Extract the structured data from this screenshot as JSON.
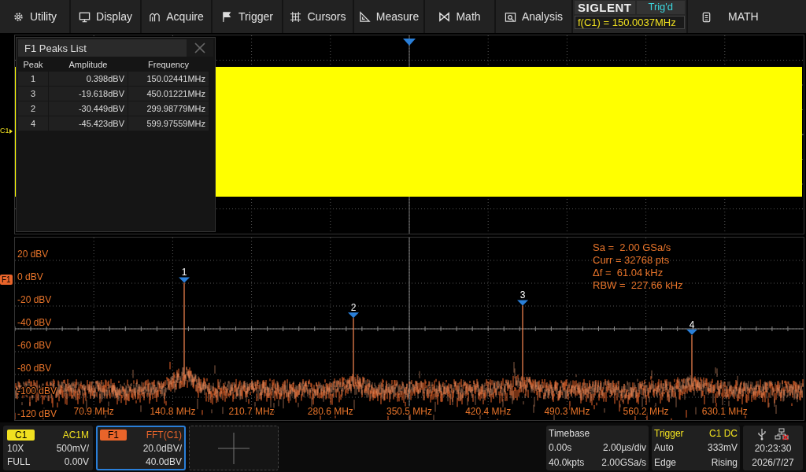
{
  "menu": [
    {
      "label": "Utility"
    },
    {
      "label": "Display"
    },
    {
      "label": "Acquire"
    },
    {
      "label": "Trigger"
    },
    {
      "label": "Cursors"
    },
    {
      "label": "Measure"
    },
    {
      "label": "Math"
    },
    {
      "label": "Analysis"
    }
  ],
  "brand": {
    "logo": "SIGLENT",
    "trigger_status": "Trig'd",
    "frequency_counter": "f(C1) = 150.0037MHz"
  },
  "math_button": {
    "label": "MATH"
  },
  "channel_markers": [
    {
      "label": "C1",
      "kind": "channel"
    },
    {
      "label": "F1",
      "kind": "math"
    }
  ],
  "peaks_list": {
    "title": "F1 Peaks List",
    "columns": [
      "Peak",
      "Amplitude",
      "Frequency"
    ],
    "rows": [
      {
        "peak": "1",
        "amplitude": "0.398dBV",
        "frequency": "150.02441MHz"
      },
      {
        "peak": "3",
        "amplitude": "-19.618dBV",
        "frequency": "450.01221MHz"
      },
      {
        "peak": "2",
        "amplitude": "-30.449dBV",
        "frequency": "299.98779MHz"
      },
      {
        "peak": "4",
        "amplitude": "-45.423dBV",
        "frequency": "599.97559MHz"
      }
    ]
  },
  "spectrum": {
    "y_labels": [
      "20 dBV",
      "0 dBV",
      "-20 dBV",
      "-40 dBV",
      "-60 dBV",
      "-80 dBV",
      "-100 dBV",
      "-120 dBV"
    ],
    "x_labels": [
      "70.9 MHz",
      "140.8 MHz",
      "210.7 MHz",
      "280.6 MHz",
      "350.5 MHz",
      "420.4 MHz",
      "490.3 MHz",
      "560.2 MHz",
      "630.1 MHz"
    ],
    "peak_markers": [
      {
        "label": "1"
      },
      {
        "label": "3"
      },
      {
        "label": "2"
      },
      {
        "label": "4"
      }
    ],
    "stats": [
      "Sa =  2.00 GSa/s",
      "Curr = 32768 pts",
      "Δf =  61.04 kHz",
      "RBW =  227.66 kHz"
    ]
  },
  "channels": [
    {
      "label": "C1",
      "kind": "channel",
      "selected": false,
      "tag": "AC1M",
      "rows": [
        {
          "left": "10X",
          "right": "500mV/"
        },
        {
          "left": "FULL",
          "right": "0.00V"
        }
      ]
    },
    {
      "label": "F1",
      "kind": "math",
      "selected": true,
      "tag": "FFT(C1)",
      "rows": [
        {
          "right": "20.0dBV/"
        },
        {
          "right": "40.0dBV"
        }
      ]
    }
  ],
  "timebase": {
    "title": "Timebase",
    "rows": [
      {
        "left": "0.00s",
        "right": "2.00µs/div"
      },
      {
        "left": "40.0kpts",
        "right": "2.00GSa/s"
      }
    ]
  },
  "trigger": {
    "title": "Trigger",
    "tag": "C1 DC",
    "rows": [
      {
        "left": "Auto",
        "right": "333mV"
      },
      {
        "left": "Edge",
        "right": "Rising"
      }
    ]
  },
  "clock": {
    "time": "20:23:30",
    "date": "2026/7/27"
  }
}
